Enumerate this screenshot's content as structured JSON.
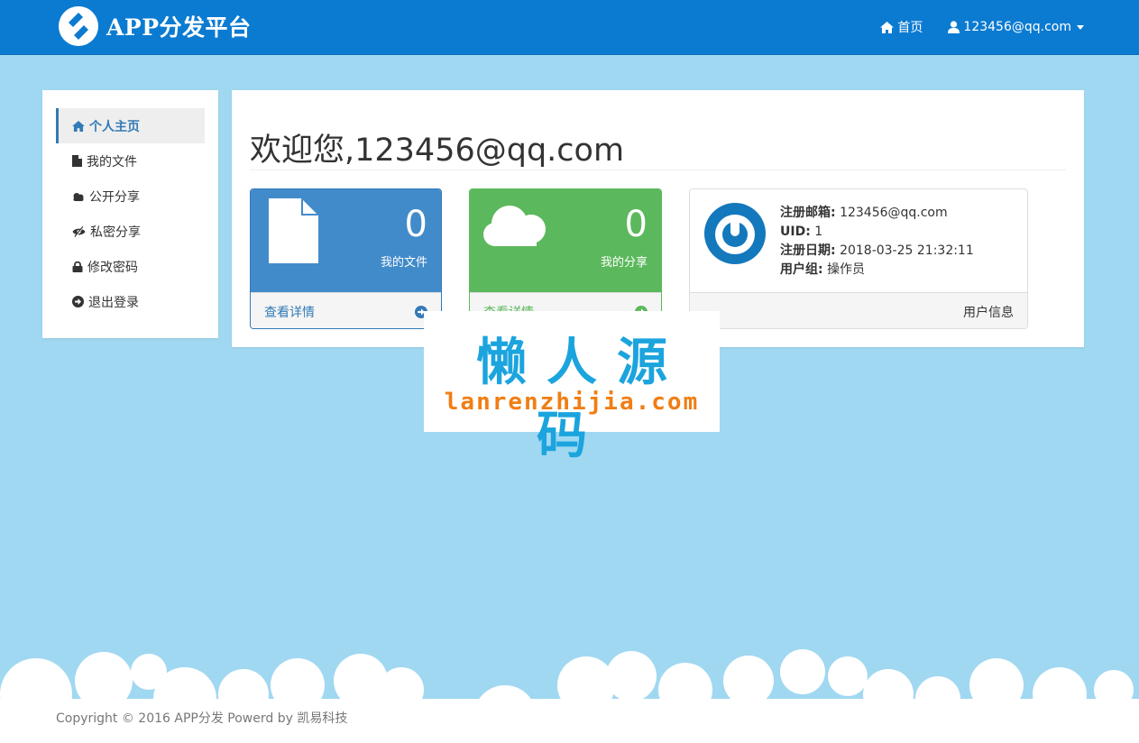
{
  "navbar": {
    "brand": "APP分发平台",
    "home_label": "首页",
    "user_label": "123456@qq.com"
  },
  "sidebar": {
    "items": [
      {
        "label": "个人主页",
        "icon": "home-icon",
        "active": true
      },
      {
        "label": "我的文件",
        "icon": "file-icon"
      },
      {
        "label": "公开分享",
        "icon": "cloud-icon"
      },
      {
        "label": "私密分享",
        "icon": "eye-slash-icon"
      },
      {
        "label": "修改密码",
        "icon": "lock-icon"
      },
      {
        "label": "退出登录",
        "icon": "arrow-circle-right-icon"
      }
    ]
  },
  "main": {
    "welcome": "欢迎您,123456@qq.com",
    "cards": [
      {
        "count": "0",
        "label": "我的文件",
        "link": "查看详情",
        "color": "#428bca"
      },
      {
        "count": "0",
        "label": "我的分享",
        "link": "查看详情",
        "color": "#5cb85c"
      }
    ],
    "user_card": {
      "email_label": "注册邮箱:",
      "email": "123456@qq.com",
      "uid_label": "UID:",
      "uid": "1",
      "date_label": "注册日期:",
      "date": "2018-03-25 21:32:11",
      "group_label": "用户组:",
      "group": "操作员",
      "footer": "用户信息"
    }
  },
  "watermark": {
    "title": "懒人源码",
    "url": "lanrenzhijia.com"
  },
  "footer": {
    "text": "Copyright © 2016 APP分发 Powerd by 凯易科技"
  },
  "colors": {
    "navbar": "#0b7bd1",
    "background": "#a0d8f1",
    "primary": "#428bca",
    "success": "#5cb85c"
  }
}
